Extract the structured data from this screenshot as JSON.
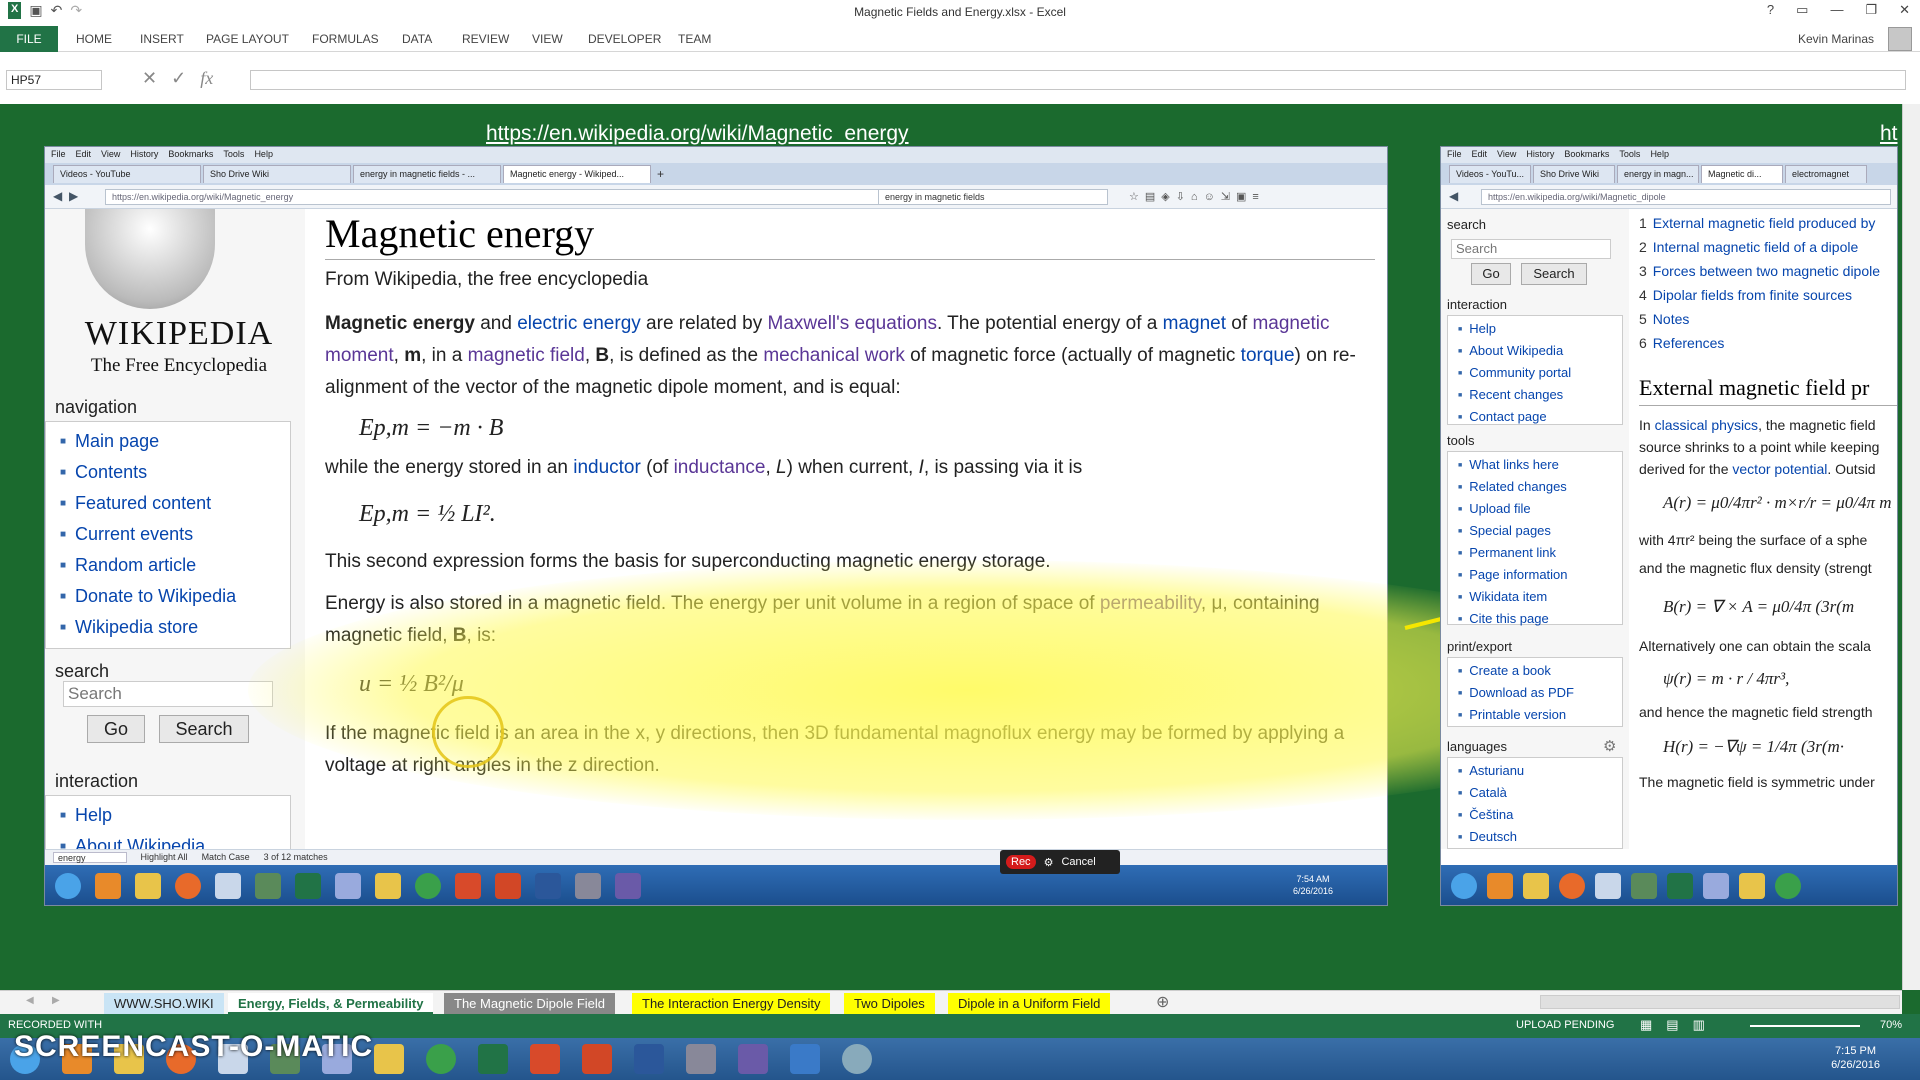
{
  "excel": {
    "title": "Magnetic Fields and Energy.xlsx - Excel",
    "user": "Kevin Marinas",
    "file_tab": "FILE",
    "ribbon_tabs": [
      "HOME",
      "INSERT",
      "PAGE LAYOUT",
      "FORMULAS",
      "DATA",
      "REVIEW",
      "VIEW",
      "DEVELOPER",
      "TEAM"
    ],
    "name_box": "HP57",
    "fx": "fx",
    "sheet_tabs": [
      "WWW.SHO.WIKI",
      "Energy, Fields, & Permeability",
      "The Magnetic Dipole Field",
      "The Interaction Energy Density",
      "Two Dipoles",
      "Dipole in a Uniform Field"
    ],
    "status_left": "RECORDED WITH",
    "status_upload": "UPLOAD PENDING",
    "zoom": "70%",
    "clock_time": "7:15 PM",
    "clock_date": "6/26/2016",
    "watermark": "SCREENCAST-O-MATIC"
  },
  "url_caption": "https://en.wikipedia.org/wiki/Magnetic_energy",
  "url_caption2": "ht",
  "left_browser": {
    "menu": [
      "File",
      "Edit",
      "View",
      "History",
      "Bookmarks",
      "Tools",
      "Help"
    ],
    "tabs": [
      "Videos - YouTube",
      "Sho Drive Wiki",
      "energy in magnetic fields - ...",
      "Magnetic energy - Wikiped..."
    ],
    "url": "https://en.wikipedia.org/wiki/Magnetic_energy",
    "search": "energy in magnetic fields",
    "wiki_title": "WIKIPEDIA",
    "wiki_sub": "The Free Encyclopedia",
    "navigation_heading": "navigation",
    "navigation": [
      "Main page",
      "Contents",
      "Featured content",
      "Current events",
      "Random article",
      "Donate to Wikipedia",
      "Wikipedia store"
    ],
    "search_heading": "search",
    "search_placeholder": "Search",
    "go": "Go",
    "search_btn": "Search",
    "interaction_heading": "interaction",
    "interaction": [
      "Help",
      "About Wikipedia"
    ],
    "article": {
      "title": "Magnetic energy",
      "tagline": "From Wikipedia, the free encyclopedia",
      "p1": {
        "b1": "Magnetic energy",
        "t1": " and ",
        "l1": "electric energy",
        "t2": " are related by ",
        "l2": "Maxwell's equations",
        "t3": ". The potential energy of a ",
        "l3": "magnet",
        "t4": " of ",
        "l4": "magnetic moment",
        "t5": ", ",
        "b2": "m",
        "t6": ", in a ",
        "l5": "magnetic field",
        "t7": ", ",
        "b3": "B",
        "t8": ", is defined as the ",
        "l6": "mechanical work",
        "t9": " of magnetic force (actually of magnetic ",
        "l7": "torque",
        "t10": ") on re-alignment of the vector of the magnetic dipole moment, and is equal:"
      },
      "eq1": "Ep,m = −m · B",
      "p2": {
        "t1": "while the energy stored in an ",
        "l1": "inductor",
        "t2": " (of ",
        "l2": "inductance",
        "t3": ", ",
        "i1": "L",
        "t4": ") when current, ",
        "i2": "I",
        "t5": ", is passing via it is"
      },
      "eq2": "Ep,m = ½ LI².",
      "p3": "This second expression forms the basis for superconducting magnetic energy storage.",
      "p4": {
        "t1": "Energy is also stored in a magnetic field. The energy per unit volume in a region of space of ",
        "l1": "permeability",
        "t2": ", μ, containing magnetic field, ",
        "b1": "B",
        "t3": ", is:"
      },
      "eq3": "u = ½ B²/μ",
      "p5": "If the magnetic field is an area in the x, y directions, then 3D fundamental magnoflux energy may be formed by applying a voltage at right angles in the z direction."
    },
    "findbar": {
      "term": "energy",
      "highlight": "Highlight All",
      "match_case": "Match Case",
      "count": "3 of 12 matches"
    },
    "clock_time": "7:54 AM",
    "clock_date": "6/26/2016"
  },
  "rec": {
    "rec": "Rec",
    "cancel": "Cancel"
  },
  "right_browser": {
    "menu": [
      "File",
      "Edit",
      "View",
      "History",
      "Bookmarks",
      "Tools",
      "Help"
    ],
    "tabs": [
      "Videos - YouTu...",
      "Sho Drive Wiki",
      "energy in magn...",
      "Magnetic di...",
      "electromagnet"
    ],
    "url": "https://en.wikipedia.org/wiki/Magnetic_dipole",
    "search_heading": "search",
    "search_placeholder": "Search",
    "go": "Go",
    "search_btn": "Search",
    "interaction_heading": "interaction",
    "interaction": [
      "Help",
      "About Wikipedia",
      "Community portal",
      "Recent changes",
      "Contact page"
    ],
    "tools_heading": "tools",
    "tools": [
      "What links here",
      "Related changes",
      "Upload file",
      "Special pages",
      "Permanent link",
      "Page information",
      "Wikidata item",
      "Cite this page"
    ],
    "print_heading": "print/export",
    "print": [
      "Create a book",
      "Download as PDF",
      "Printable version"
    ],
    "languages_heading": "languages",
    "languages": [
      "Asturianu",
      "Català",
      "Čeština",
      "Deutsch"
    ],
    "toc": [
      {
        "n": "1",
        "t": "External magnetic field produced by"
      },
      {
        "n": "2",
        "t": "Internal magnetic field of a dipole"
      },
      {
        "n": "3",
        "t": "Forces between two magnetic dipole"
      },
      {
        "n": "4",
        "t": "Dipolar fields from finite sources"
      },
      {
        "n": "5",
        "t": "Notes"
      },
      {
        "n": "6",
        "t": "References"
      }
    ],
    "heading": "External magnetic field pr",
    "p1a": "In ",
    "p1l": "classical physics",
    "p1b": ", the magnetic field",
    "p1c": "source shrinks to a point while keeping",
    "p1d": "derived for the ",
    "p1l2": "vector potential",
    "p1e": ". Outsid",
    "eq1": "A(r) = μ0/4πr² · m×r/r = μ0/4π m",
    "p2": "with 4πr² being the surface of a sphe",
    "p3": "and the magnetic flux density (strengt",
    "eq2": "B(r) = ∇ × A = μ0/4π (3r(m",
    "p4": "Alternatively one can obtain the scala",
    "eq3": "ψ(r) = m · r / 4πr³,",
    "p5": "and hence the magnetic field strength",
    "eq4": "H(r) = −∇ψ = 1/4π (3r(m·",
    "p6": "The magnetic field is symmetric under"
  },
  "colors": {
    "excel_green": "#217346",
    "highlight": "#fff950",
    "link": "#0645ad"
  }
}
